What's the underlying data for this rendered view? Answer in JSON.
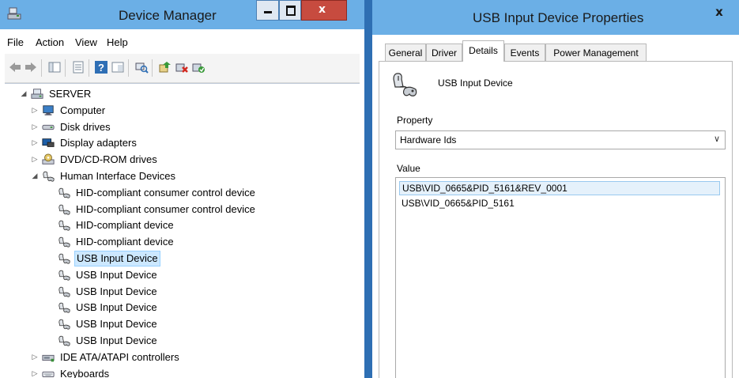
{
  "device_manager": {
    "title": "Device Manager",
    "caption_close": "x",
    "menu": [
      "File",
      "Action",
      "View",
      "Help"
    ],
    "tree": [
      {
        "label": "SERVER",
        "expander": "open",
        "icon": "computer-server-icon",
        "level": 0
      },
      {
        "label": "Computer",
        "expander": "closed",
        "icon": "monitor-icon",
        "level": 1
      },
      {
        "label": "Disk drives",
        "expander": "closed",
        "icon": "disk-drive-icon",
        "level": 1
      },
      {
        "label": "Display adapters",
        "expander": "closed",
        "icon": "display-adapter-icon",
        "level": 1
      },
      {
        "label": "DVD/CD-ROM drives",
        "expander": "closed",
        "icon": "dvd-drive-icon",
        "level": 1
      },
      {
        "label": "Human Interface Devices",
        "expander": "open",
        "icon": "hid-icon",
        "level": 1
      },
      {
        "label": "HID-compliant consumer control device",
        "expander": "none",
        "icon": "hid-icon",
        "level": 2
      },
      {
        "label": "HID-compliant consumer control device",
        "expander": "none",
        "icon": "hid-icon",
        "level": 2
      },
      {
        "label": "HID-compliant device",
        "expander": "none",
        "icon": "hid-icon",
        "level": 2
      },
      {
        "label": "HID-compliant device",
        "expander": "none",
        "icon": "hid-icon",
        "level": 2
      },
      {
        "label": "USB Input Device",
        "expander": "none",
        "icon": "hid-icon",
        "level": 2,
        "selected": true
      },
      {
        "label": "USB Input Device",
        "expander": "none",
        "icon": "hid-icon",
        "level": 2
      },
      {
        "label": "USB Input Device",
        "expander": "none",
        "icon": "hid-icon",
        "level": 2
      },
      {
        "label": "USB Input Device",
        "expander": "none",
        "icon": "hid-icon",
        "level": 2
      },
      {
        "label": "USB Input Device",
        "expander": "none",
        "icon": "hid-icon",
        "level": 2
      },
      {
        "label": "USB Input Device",
        "expander": "none",
        "icon": "hid-icon",
        "level": 2
      },
      {
        "label": "IDE ATA/ATAPI controllers",
        "expander": "closed",
        "icon": "ide-controller-icon",
        "level": 1
      },
      {
        "label": "Keyboards",
        "expander": "closed",
        "icon": "keyboard-icon",
        "level": 1
      }
    ]
  },
  "properties": {
    "title": "USB Input Device Properties",
    "close_label": "x",
    "tabs": [
      {
        "label": "General"
      },
      {
        "label": "Driver"
      },
      {
        "label": "Details",
        "active": true
      },
      {
        "label": "Events"
      },
      {
        "label": "Power Management"
      }
    ],
    "device_name": "USB Input Device",
    "property_label": "Property",
    "property_value": "Hardware Ids",
    "value_label": "Value",
    "values": [
      {
        "text": "USB\\VID_0665&PID_5161&REV_0001",
        "selected": true
      },
      {
        "text": "USB\\VID_0665&PID_5161"
      }
    ]
  },
  "colors": {
    "title_bar": "#6bafe6",
    "window_frame": "#2e6fb3",
    "close_button": "#c74b3f",
    "selection": "#cce8ff"
  }
}
